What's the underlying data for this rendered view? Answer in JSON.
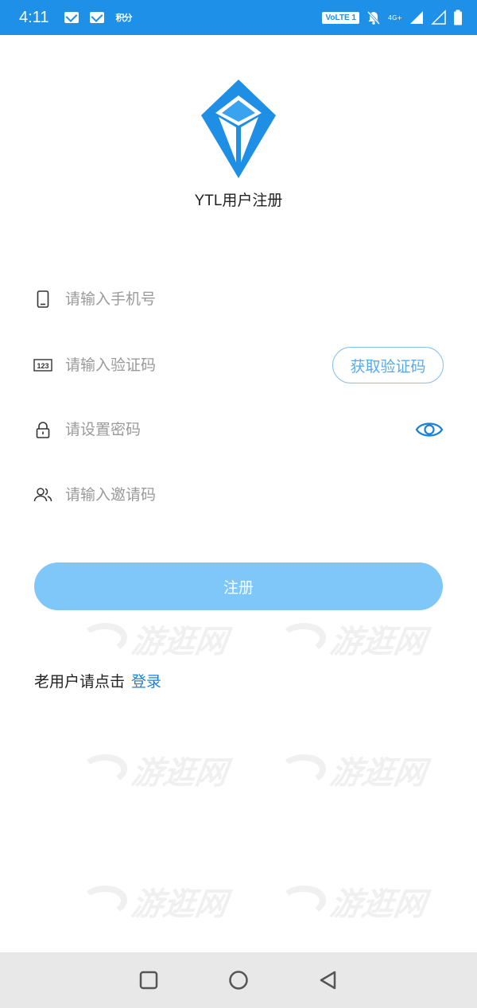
{
  "status_bar": {
    "time": "4:11",
    "app_notif_label": "积分",
    "volte_label": "VoLTE 1",
    "network_label": "4G+",
    "icons": [
      "mail-icon",
      "mail-icon",
      "app-notification-icon",
      "mute-icon",
      "signal-icon",
      "signal-empty-icon",
      "battery-icon"
    ]
  },
  "app": {
    "title": "YTL用户注册",
    "logo": "diamond-logo",
    "accent_color": "#1e90e8"
  },
  "form": {
    "phone": {
      "placeholder": "请输入手机号",
      "value": "",
      "icon": "phone-icon"
    },
    "code": {
      "placeholder": "请输入验证码",
      "value": "",
      "icon": "numeric-123-icon",
      "button_label": "获取验证码"
    },
    "password": {
      "placeholder": "请设置密码",
      "value": "",
      "icon": "lock-icon",
      "toggle_icon": "eye-icon"
    },
    "invite": {
      "placeholder": "请输入邀请码",
      "value": "",
      "icon": "users-icon"
    },
    "submit_label": "注册"
  },
  "login": {
    "prompt": "老用户请点击",
    "link_label": "登录"
  },
  "watermark": {
    "text": "游逛网"
  },
  "nav_bar": {
    "items": [
      "recents-icon",
      "home-icon",
      "back-icon"
    ]
  }
}
